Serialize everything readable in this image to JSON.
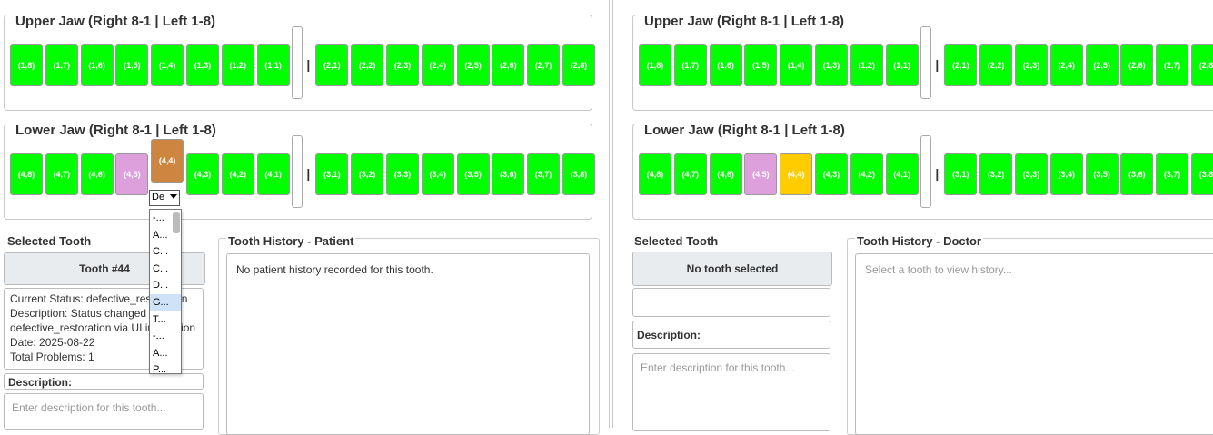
{
  "left": {
    "upper_title": "Upper Jaw (Right 8-1 | Left 1-8)",
    "lower_title": "Lower Jaw (Right 8-1 | Left 1-8)",
    "separator": "|",
    "upper_right": [
      "(1,8)",
      "(1,7)",
      "(1,6)",
      "(1,5)",
      "(1,4)",
      "(1,3)",
      "(1,2)",
      "(1,1)"
    ],
    "upper_left": [
      "(2,1)",
      "(2,2)",
      "(2,3)",
      "(2,4)",
      "(2,5)",
      "(2,6)",
      "(2,7)",
      "(2,8)"
    ],
    "lower_right": [
      "(4,8)",
      "(4,7)",
      "(4,6)",
      "(4,5)",
      "(4,4)",
      "(4,3)",
      "(4,2)",
      "(4,1)"
    ],
    "lower_left": [
      "(3,1)",
      "(3,2)",
      "(3,3)",
      "(3,4)",
      "(3,5)",
      "(3,6)",
      "(3,7)",
      "(3,8)"
    ],
    "dropdown_value": "De",
    "dropdown_options": [
      "-...",
      "A...",
      "C...",
      "C...",
      "D...",
      "G...",
      "T...",
      "-...",
      "A...",
      "P..."
    ],
    "selected_title": "Selected Tooth",
    "selected_button": "Tooth #44",
    "info_lines": [
      "Current Status: defective_restoration",
      "Description: Status changed to",
      "defective_restoration via UI interaction",
      "Date: 2025-08-22",
      "Total Problems: 1"
    ],
    "description_label": "Description:",
    "description_placeholder": "Enter description for this tooth...",
    "history_title": "Tooth History - Patient",
    "history_text": "No patient history recorded for this tooth."
  },
  "right": {
    "upper_title": "Upper Jaw (Right 8-1 | Left 1-8)",
    "lower_title": "Lower Jaw (Right 8-1 | Left 1-8)",
    "separator": "|",
    "selected_title": "Selected Tooth",
    "selected_button": "No tooth selected",
    "description_label": "Description:",
    "description_placeholder": "Enter description for this tooth...",
    "history_title": "Tooth History - Doctor",
    "history_placeholder": "Select a tooth to view history..."
  },
  "colors": {
    "healthy": "#00ff00",
    "lilac": "#dda0dd",
    "defective": "#cd853f",
    "selected_gold": "#ffcc00"
  }
}
